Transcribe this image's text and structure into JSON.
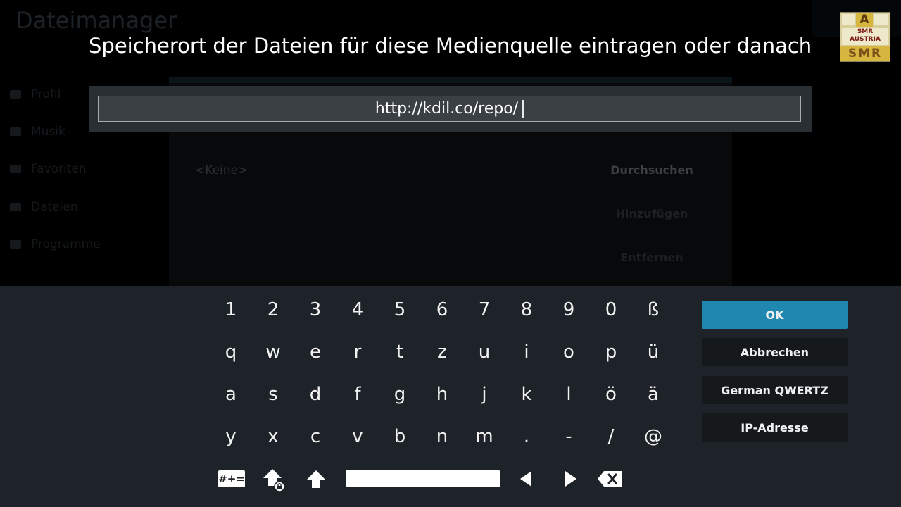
{
  "background": {
    "title": "Dateimanager",
    "sidebar_items": [
      "Profil",
      "Musik",
      "Favoriten",
      "Dateien",
      "Programme"
    ],
    "dialog_none": "<Keine>",
    "dialog_buttons": [
      "Durchsuchen",
      "Hinzufügen",
      "Entfernen"
    ]
  },
  "dialog": {
    "heading": "Speicherort der Dateien für diese Medienquelle eintragen oder danach su…",
    "input_value": "http://kdil.co/repo/"
  },
  "logo": {
    "letter": "A",
    "middle_line1": "SMR",
    "middle_line2": "AUSTRIA",
    "bottom": "SMR"
  },
  "keyboard": {
    "rows": [
      [
        "1",
        "2",
        "3",
        "4",
        "5",
        "6",
        "7",
        "8",
        "9",
        "0",
        "ß"
      ],
      [
        "q",
        "w",
        "e",
        "r",
        "t",
        "z",
        "u",
        "i",
        "o",
        "p",
        "ü"
      ],
      [
        "a",
        "s",
        "d",
        "f",
        "g",
        "h",
        "j",
        "k",
        "l",
        "ö",
        "ä"
      ],
      [
        "y",
        "x",
        "c",
        "v",
        "b",
        "n",
        "m",
        ".",
        "-",
        "/",
        "@"
      ]
    ],
    "symbols_label": "#+=",
    "side_buttons": {
      "ok": "OK",
      "cancel": "Abbrechen",
      "layout": "German QWERTZ",
      "ip": "IP-Adresse"
    }
  },
  "colors": {
    "accent": "#1f87b0",
    "keyboard_bg": "#1d2328",
    "input_panel": "#2a2f33"
  }
}
